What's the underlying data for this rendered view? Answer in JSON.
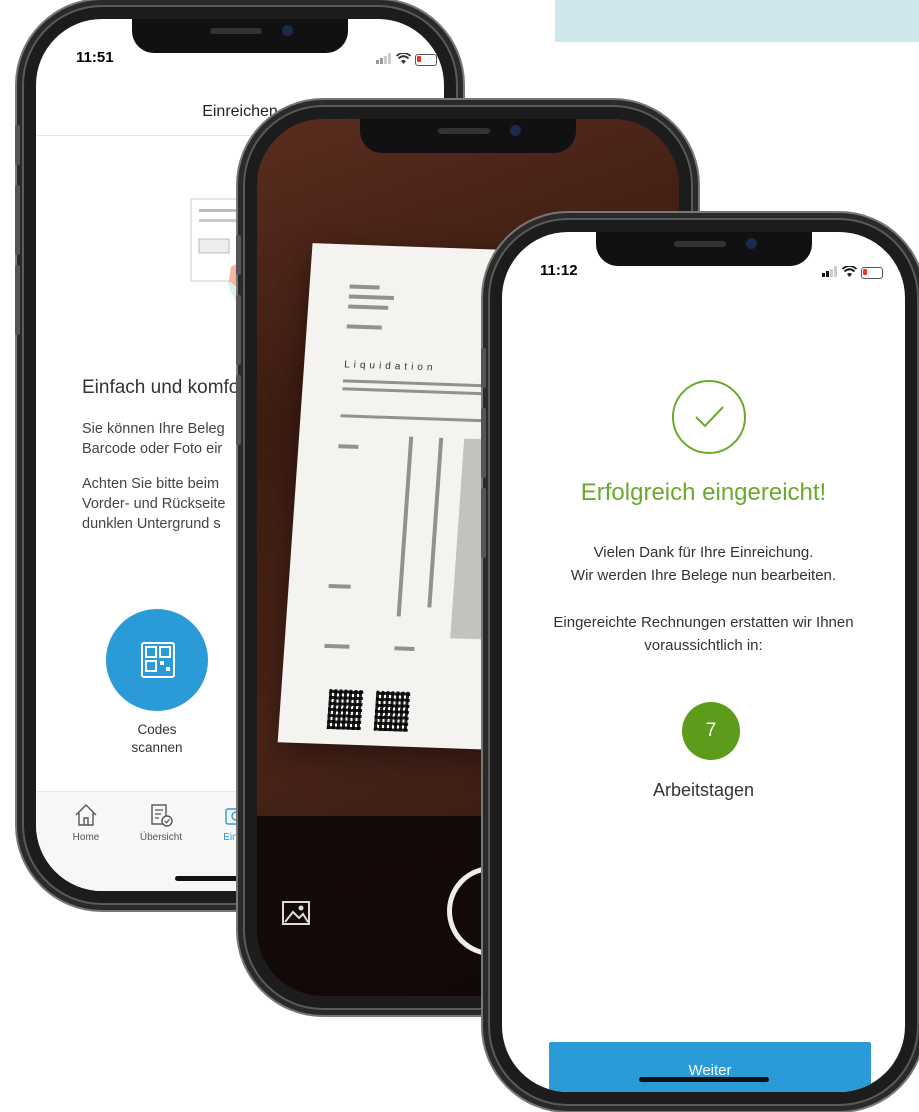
{
  "screen1": {
    "time": "11:51",
    "nav_title": "Einreichen",
    "heading": "Einfach und komfo",
    "para1_line1": "Sie können Ihre Beleg",
    "para1_line2": "Barcode oder Foto eir",
    "para2_line1": "Achten Sie bitte beim",
    "para2_line2": "Vorder- und Rückseite",
    "para2_line3": "dunklen Untergrund s",
    "scan_label_line1": "Codes",
    "scan_label_line2": "scannen",
    "tabs": [
      {
        "label": "Home",
        "icon": "home-icon"
      },
      {
        "label": "Übersicht",
        "icon": "overview-icon"
      },
      {
        "label": "Einrei",
        "icon": "camera-icon"
      }
    ],
    "accent_color": "#2a9bd6"
  },
  "screen2": {
    "document_title": "Liquidation"
  },
  "screen3": {
    "time": "11:12",
    "success_title": "Erfolgreich eingereicht!",
    "thanks_line1": "Vielen Dank für Ihre Einreichung.",
    "thanks_line2": "Wir werden Ihre Belege nun bearbeiten.",
    "refund_line1": "Eingereichte Rechnungen erstatten wir Ihnen",
    "refund_line2": "voraussichtlich in:",
    "days_value": "7",
    "days_label": "Arbeitstagen",
    "continue_button": "Weiter",
    "success_color": "#6aaa2a",
    "button_color": "#2a9bd6"
  }
}
